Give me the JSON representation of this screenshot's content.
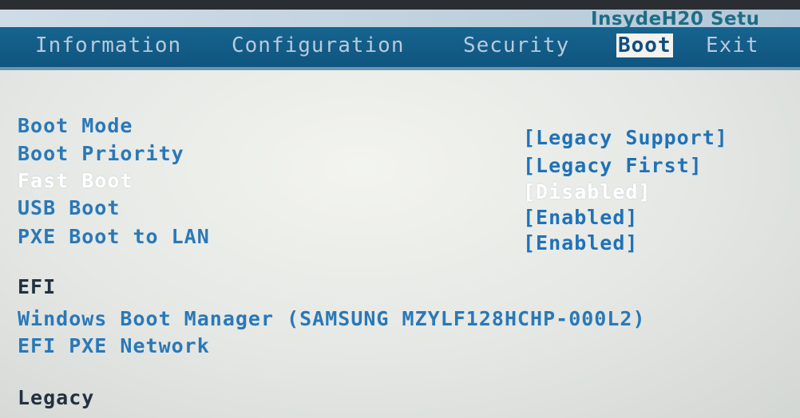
{
  "window": {
    "title": "InsydeH20 Setu"
  },
  "menu": {
    "tabs": [
      "Information",
      "Configuration",
      "Security",
      "Boot",
      "Exit"
    ],
    "active_tab": "Boot"
  },
  "settings": [
    {
      "label": "Boot Mode",
      "value": "[Legacy Support]"
    },
    {
      "label": "Boot Priority",
      "value": "[Legacy First]"
    },
    {
      "label": "Fast Boot",
      "value": "[Disabled]"
    },
    {
      "label": "USB Boot",
      "value": "[Enabled]"
    },
    {
      "label": "PXE Boot to LAN",
      "value": "[Enabled]"
    }
  ],
  "efi": {
    "heading": "EFI",
    "items": [
      "Windows Boot Manager (SAMSUNG MZYLF128HCHP-000L2)",
      "EFI PXE Network"
    ]
  },
  "legacy": {
    "heading": "Legacy"
  },
  "colors": {
    "menu_bar": "#16648f",
    "item_text": "#2a78b8",
    "value_text": "#1f72b8",
    "selected_text": "#ffffff",
    "title_text": "#1f6c85"
  }
}
